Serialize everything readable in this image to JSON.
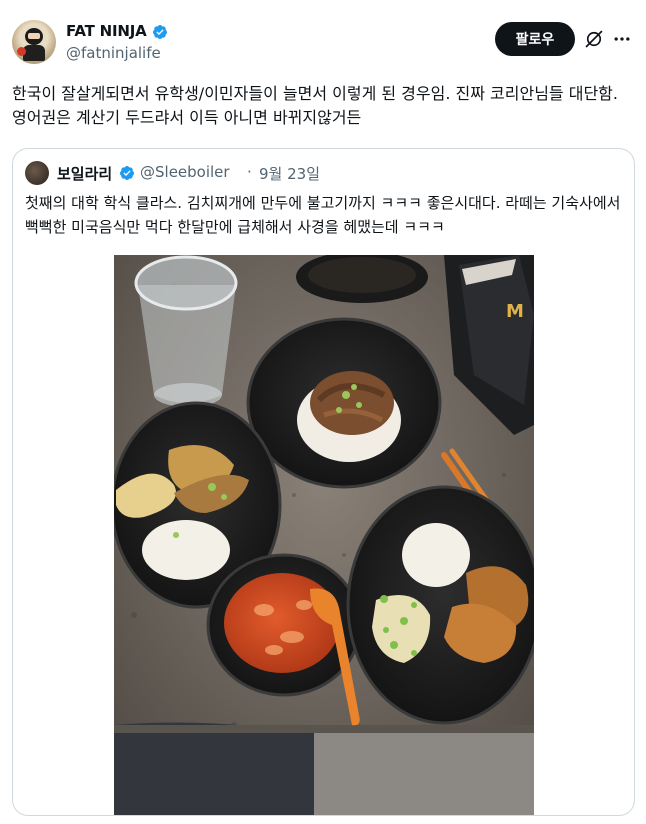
{
  "author": {
    "display_name": "FAT NINJA",
    "handle": "@fatninjalife"
  },
  "actions": {
    "follow_label": "팔로우"
  },
  "tweet": {
    "text": "한국이 잘살게되면서 유학생/이민자들이 늘면서 이렇게 된 경우임. 진짜 코리안님들 대단함.  영어권은 계산기 두드랴서 이득 아니면 바뀌지않거든"
  },
  "quoted": {
    "display_name": "보일라리",
    "handle": "@Sleeboiler",
    "separator": "·",
    "date": "9월 23일",
    "text": "첫째의 대학 학식 클라스. 김치찌개에 만두에 불고기까지 ㅋㅋㅋ 좋은시대다. 라떼는 기숙사에서 뻑뻑한 미국음식만 먹다 한달만에 급체해서 사경을 헤맸는데 ㅋㅋㅋ"
  },
  "colors": {
    "verified_blue": "#1d9bf0",
    "text_primary": "#0f1419",
    "text_secondary": "#536471",
    "border": "#cfd9de"
  },
  "icons": {
    "verified": "verified-badge-icon",
    "grok": "grok-icon",
    "more": "more-options-icon"
  }
}
